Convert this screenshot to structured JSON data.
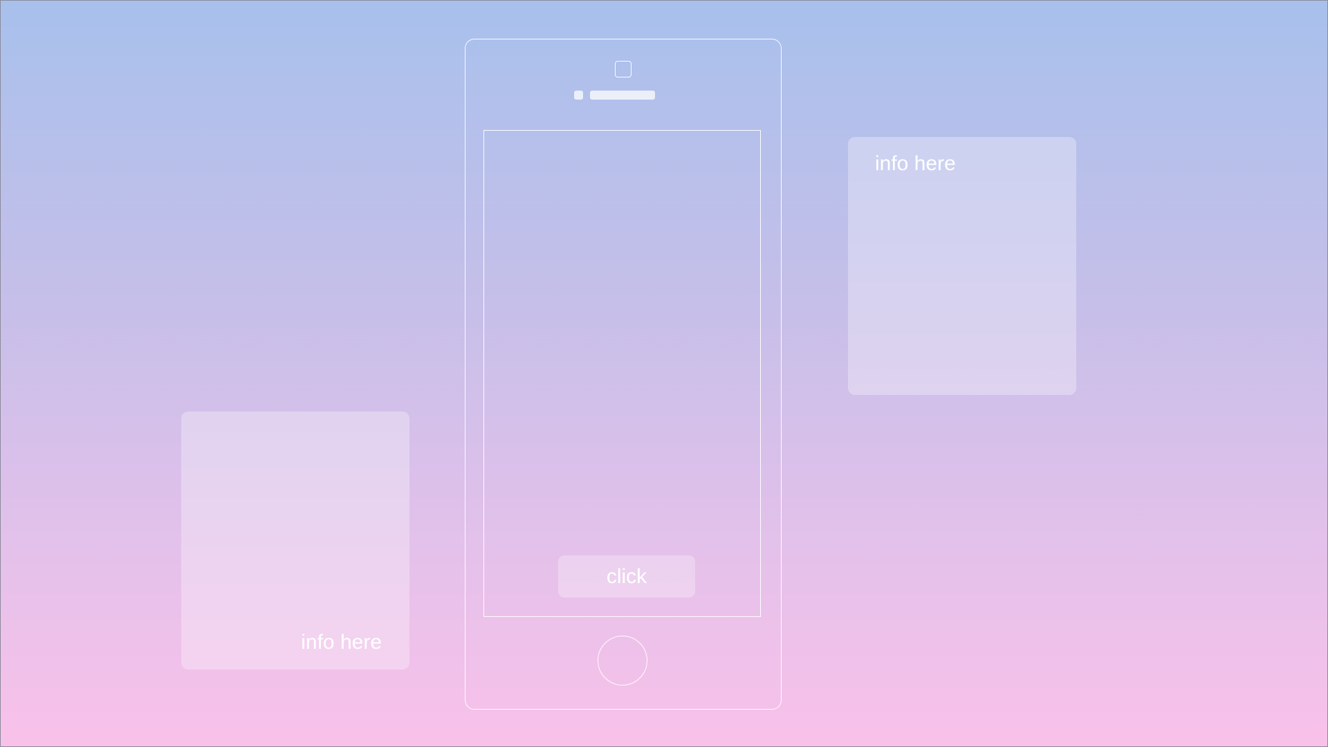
{
  "phone": {
    "button_label": "click"
  },
  "cards": {
    "right_text": "info here",
    "left_text": "info here"
  },
  "colors": {
    "gradient_top": "#a8c0ec",
    "gradient_bottom": "#f9c1ea",
    "outline": "#ffffff"
  }
}
